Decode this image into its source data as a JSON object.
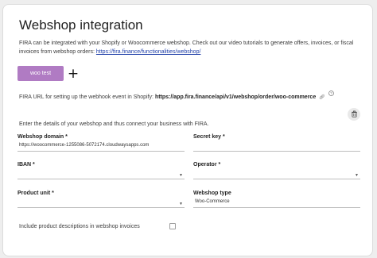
{
  "header": {
    "title": "Webshop integration"
  },
  "intro": {
    "text": "FIRA can be integrated with your Shopify or Woocommerce webshop. Check out our video tutorials to generate offers, invoices, or fiscal invoices from webshop orders: ",
    "link": "https://fira.finance/functionalities/webshop/"
  },
  "webshops": {
    "active_label": "woo test",
    "add_symbol": "+"
  },
  "webhook": {
    "prefix": "FIRA URL for setting up the webhook event in Shopify: ",
    "url": "https://app.fira.finance/api/v1/webshop/order/woo-commerce"
  },
  "form": {
    "instructions": "Enter the details of your webshop and thus connect your business with FIRA.",
    "domain_label": "Webshop domain *",
    "domain_value": "https://woocommerce-1255086-5072174.cloudwaysapps.com",
    "secret_label": "Secret key *",
    "iban_label": "IBAN *",
    "operator_label": "Operator *",
    "unit_label": "Product unit *",
    "type_label": "Webshop type",
    "type_value": "Woo-Commerce",
    "descriptions_label": "Include product descriptions in webshop invoices",
    "descriptions_checked": false
  },
  "icons": {
    "link": "link-icon",
    "help": "help-icon",
    "delete": "trash-icon",
    "dropdown": "caret-down-icon"
  }
}
